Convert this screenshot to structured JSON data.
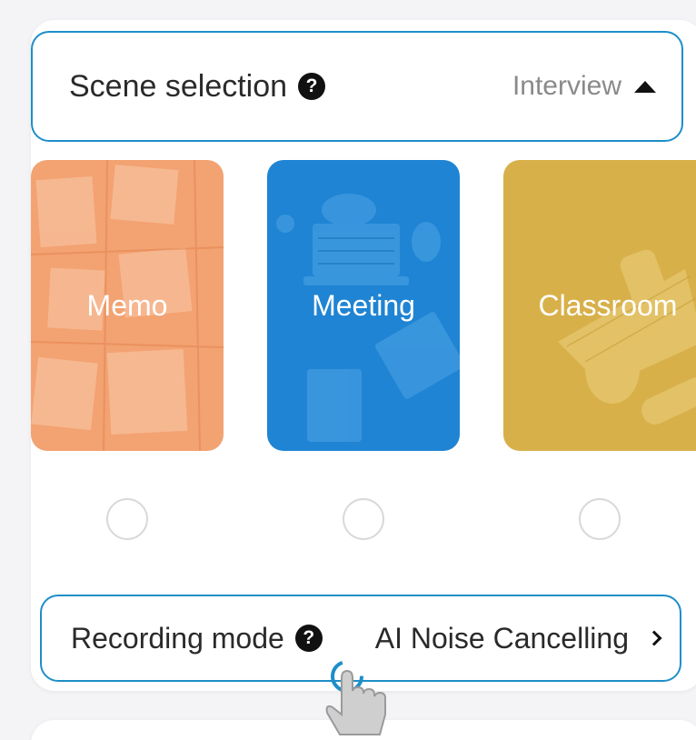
{
  "scene": {
    "label": "Scene selection",
    "help_icon": "question-circle-icon",
    "value": "Interview",
    "caret_icon": "caret-up-icon"
  },
  "scenes": [
    {
      "name": "Memo",
      "color": "#f3a272",
      "selected": false
    },
    {
      "name": "Meeting",
      "color": "#1f84d3",
      "selected": false
    },
    {
      "name": "Classroom",
      "color": "#d8b04a",
      "selected": false
    }
  ],
  "recording": {
    "label": "Recording mode",
    "help_icon": "question-circle-icon",
    "value": "AI Noise Cancelling",
    "chevron_icon": "chevron-right-icon"
  },
  "highlight_color": "#1e8ec9",
  "pointer_icon": "tap-hand-icon"
}
